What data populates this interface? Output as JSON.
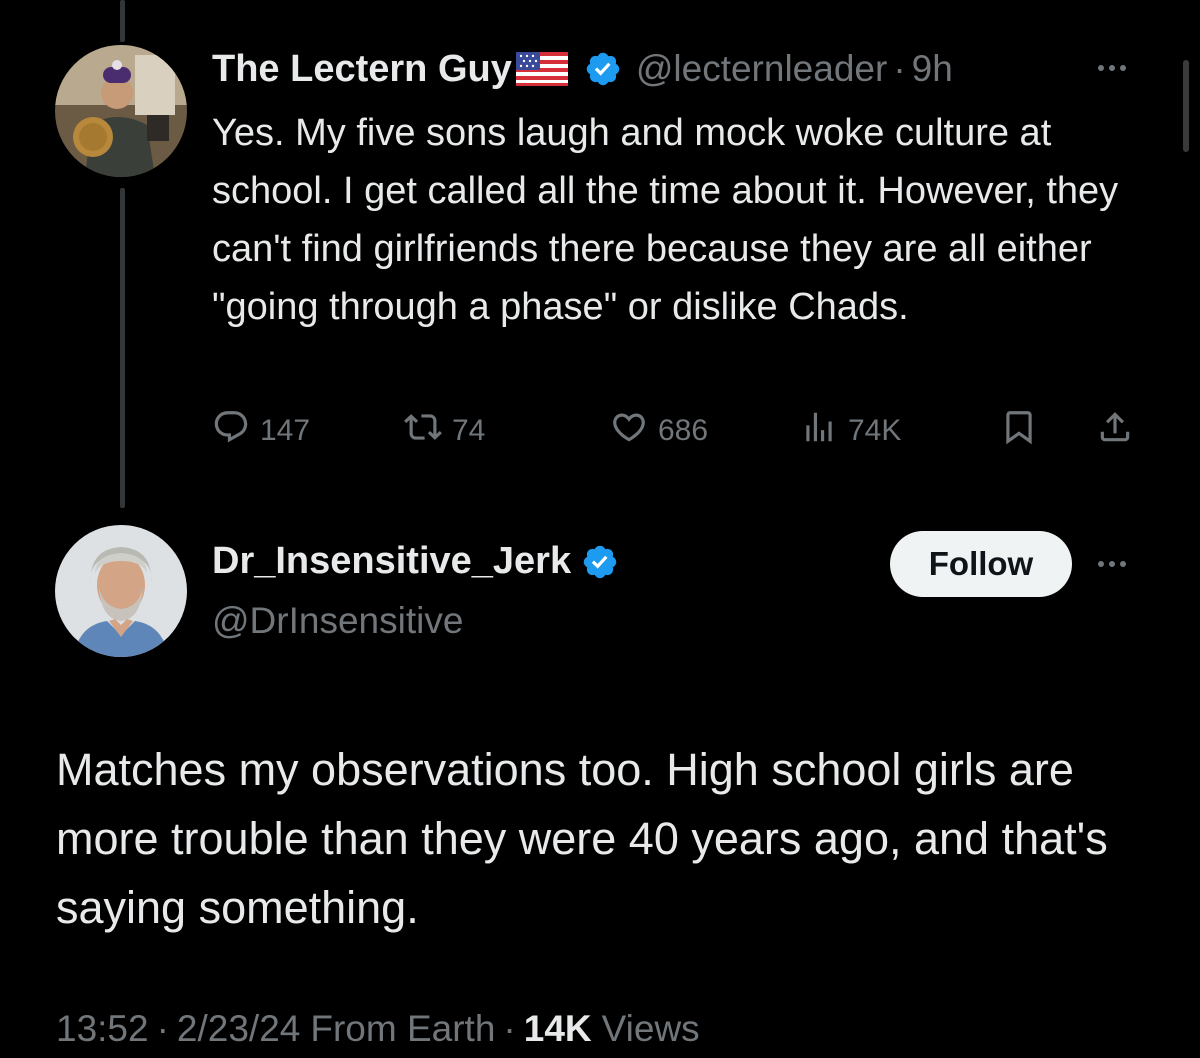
{
  "parent_tweet": {
    "display_name": "The Lectern Guy",
    "flag_icon": "us-flag-emoji",
    "verified": true,
    "handle": "@lecternleader",
    "separator": "·",
    "time_ago": "9h",
    "text": "Yes. My five sons laugh and mock woke culture at school. I get called all the time about it. However, they can't find girlfriends there because they are all either \"going through a phase\" or dislike Chads.",
    "actions": {
      "replies": "147",
      "retweets": "74",
      "likes": "686",
      "views": "74K"
    }
  },
  "main_tweet": {
    "display_name": "Dr_Insensitive_Jerk",
    "verified": true,
    "handle": "@DrInsensitive",
    "follow_label": "Follow",
    "text": "Matches my observations too. High school girls are more trouble than they were 40 years ago, and that's saying something.",
    "meta": {
      "time": "13:52",
      "date": "2/23/24",
      "source": "From Earth",
      "views_count": "14K",
      "views_label": "Views",
      "separator": "·"
    }
  },
  "colors": {
    "background": "#000000",
    "text_primary": "#e7e9ea",
    "text_secondary": "#71767b",
    "verified_blue": "#1d9bf0",
    "follow_bg": "#eff3f4"
  }
}
